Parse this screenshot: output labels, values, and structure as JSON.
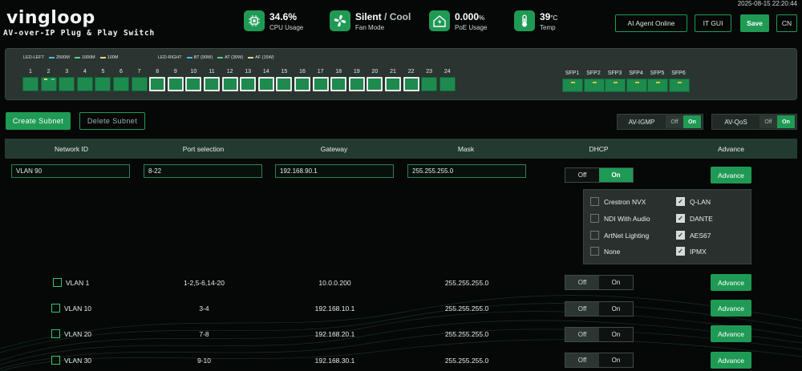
{
  "header": {
    "logo": "vingloop",
    "tagline": "AV-over-IP Plug & Play Switch",
    "timestamp": "2025-08-15 22:20:44",
    "stats": [
      {
        "icon": "cpu-icon",
        "value": "34.6%",
        "label": "CPU Usage"
      },
      {
        "icon": "fan-icon",
        "value_main": "Silent",
        "value_sep": " / ",
        "value_alt": "Cool",
        "label": "Fan Mode"
      },
      {
        "icon": "power-house-icon",
        "value": "0.000",
        "unit": "%",
        "label": "PoE Usage"
      },
      {
        "icon": "thermometer-icon",
        "value": "39",
        "unit": "°C",
        "label": "Temp"
      }
    ],
    "buttons": {
      "ai_agent": "AI Agent Online",
      "it_gui": "IT GUI",
      "save": "Save",
      "lang": "CN"
    }
  },
  "switch_panel": {
    "legend_left": {
      "title": "LED-LEFT",
      "items": [
        {
          "label": "2500M",
          "color": "#4fb3e8"
        },
        {
          "label": "1000M",
          "color": "#4fd08a"
        },
        {
          "label": "100M",
          "color": "#e6d38a"
        }
      ]
    },
    "legend_right": {
      "title": "LED-RIGHT",
      "items": [
        {
          "label": "BT (90W)",
          "color": "#4fb3e8"
        },
        {
          "label": "AT (30W)",
          "color": "#4fd08a"
        },
        {
          "label": "AF (15W)",
          "color": "#e6d38a"
        }
      ]
    },
    "ports": [
      "1",
      "2",
      "3",
      "4",
      "5",
      "6",
      "7",
      "8",
      "9",
      "10",
      "11",
      "12",
      "13",
      "14",
      "15",
      "16",
      "17",
      "18",
      "19",
      "20",
      "21",
      "22",
      "23",
      "24"
    ],
    "selected_ports": [
      8,
      9,
      10,
      11,
      12,
      13,
      14,
      15,
      16,
      17,
      18,
      19,
      20,
      21,
      22
    ],
    "port_2_leds": [
      "#e6d38a",
      "#4fd08a"
    ],
    "sfp": [
      "SFP1",
      "SFP2",
      "SFP3",
      "SFP4",
      "SFP5",
      "SFP6"
    ]
  },
  "actions": {
    "create": "Create Subnet",
    "delete": "Delete Subnet"
  },
  "features": [
    {
      "label": "AV-IGMP",
      "off": "Off",
      "on": "On",
      "state": "on"
    },
    {
      "label": "AV-QoS",
      "off": "Off",
      "on": "On",
      "state": "on"
    }
  ],
  "table": {
    "headers": [
      "Network ID",
      "Port selection",
      "Gateway",
      "Mask",
      "DHCP",
      "Advance"
    ],
    "editing": {
      "network_id": "VLAN 90",
      "ports": "8-22",
      "gateway": "192.168.90.1",
      "mask": "255.255.255.0",
      "dhcp_off": "Off",
      "dhcp_on": "On",
      "dhcp": "on",
      "advance": "Advance"
    },
    "protocols": [
      {
        "label": "Crestron NVX",
        "checked": false
      },
      {
        "label": "Q-LAN",
        "checked": true
      },
      {
        "label": "NDI With Audio",
        "checked": false
      },
      {
        "label": "DANTE",
        "checked": true
      },
      {
        "label": "ArtNet Lighting",
        "checked": false
      },
      {
        "label": "AES67",
        "checked": true
      },
      {
        "label": "None",
        "checked": false
      },
      {
        "label": "IPMX",
        "checked": true
      }
    ],
    "rows": [
      {
        "name": "VLAN 1",
        "ports": "1-2,5-6,14-20",
        "gateway": "10.0.0.200",
        "mask": "255.255.255.0",
        "off": "Off",
        "on": "On",
        "dhcp": "off",
        "advance": "Advance"
      },
      {
        "name": "VLAN 10",
        "ports": "3-4",
        "gateway": "192.168.10.1",
        "mask": "255.255.255.0",
        "off": "Off",
        "on": "On",
        "dhcp": "off",
        "advance": "Advance"
      },
      {
        "name": "VLAN 20",
        "ports": "7-8",
        "gateway": "192.168.20.1",
        "mask": "255.255.255.0",
        "off": "Off",
        "on": "On",
        "dhcp": "off",
        "advance": "Advance"
      },
      {
        "name": "VLAN 30",
        "ports": "9-10",
        "gateway": "192.168.30.1",
        "mask": "255.255.255.0",
        "off": "Off",
        "on": "On",
        "dhcp": "off",
        "advance": "Advance"
      }
    ]
  },
  "colors": {
    "accent": "#1f9a55",
    "background": "#050807",
    "panel": "#2a3430"
  }
}
